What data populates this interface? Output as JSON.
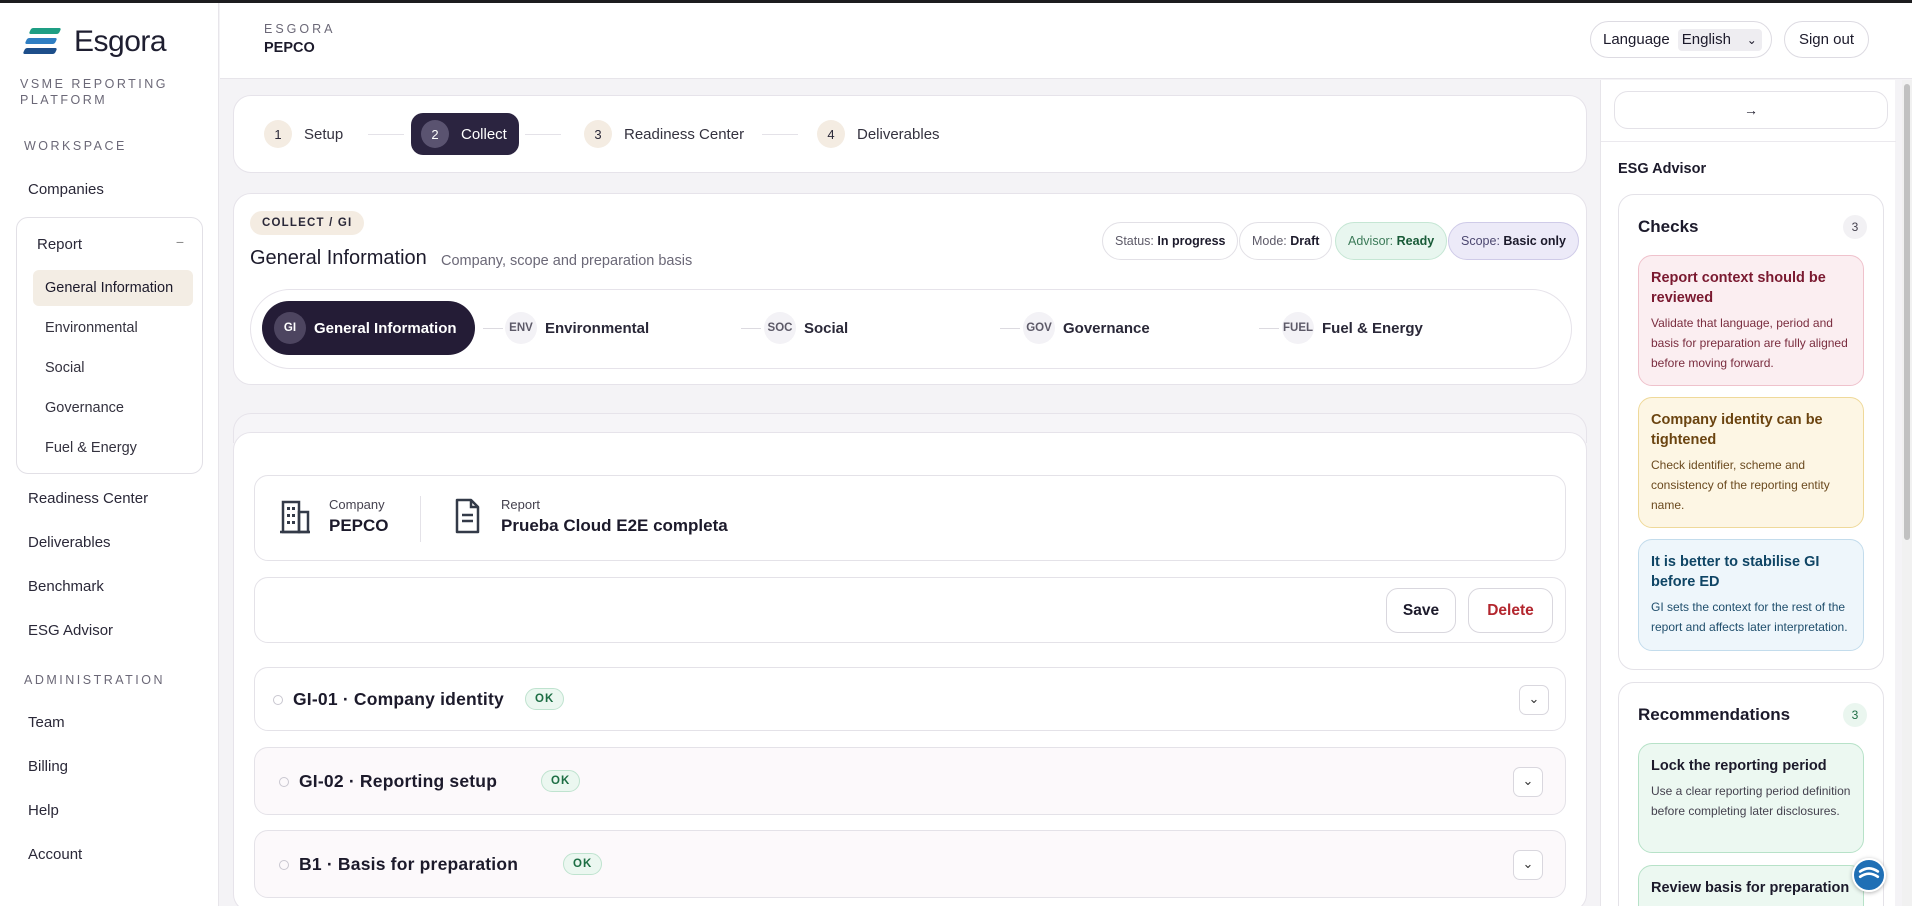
{
  "brand": {
    "name": "Esgora",
    "platform": "VSME REPORTING PLATFORM",
    "colors": [
      "#1e9e84",
      "#2f7ec2",
      "#1d4e8a"
    ]
  },
  "sidebar": {
    "workspace_label": "WORKSPACE",
    "companies": "Companies",
    "report": {
      "label": "Report",
      "toggle": "−",
      "items": [
        "General Information",
        "Environmental",
        "Social",
        "Governance",
        "Fuel & Energy"
      ]
    },
    "readiness": "Readiness Center",
    "deliverables": "Deliverables",
    "benchmark": "Benchmark",
    "esg_advisor": "ESG Advisor",
    "admin_label": "ADMINISTRATION",
    "team": "Team",
    "billing": "Billing",
    "help": "Help",
    "account": "Account"
  },
  "header": {
    "brand": "ESGORA",
    "company": "PEPCO",
    "language_label": "Language",
    "language_value": "English",
    "signout": "Sign out"
  },
  "stepper": [
    {
      "num": "1",
      "label": "Setup"
    },
    {
      "num": "2",
      "label": "Collect"
    },
    {
      "num": "3",
      "label": "Readiness Center"
    },
    {
      "num": "4",
      "label": "Deliverables"
    }
  ],
  "gi": {
    "tag": "COLLECT / GI",
    "title": "General Information",
    "subtitle": "Company, scope and preparation basis",
    "status": {
      "label": "Status:",
      "value": "In progress"
    },
    "mode": {
      "label": "Mode:",
      "value": "Draft"
    },
    "advisor": {
      "label": "Advisor:",
      "value": "Ready"
    },
    "scope": {
      "label": "Scope:",
      "value": "Basic only"
    },
    "tabs": [
      {
        "code": "GI",
        "label": "General Information"
      },
      {
        "code": "ENV",
        "label": "Environmental"
      },
      {
        "code": "SOC",
        "label": "Social"
      },
      {
        "code": "GOV",
        "label": "Governance"
      },
      {
        "code": "FUEL",
        "label": "Fuel & Energy"
      }
    ]
  },
  "form": {
    "company_label": "Company",
    "company_value": "PEPCO",
    "report_label": "Report",
    "report_value": "Prueba Cloud E2E completa",
    "save": "Save",
    "delete": "Delete",
    "sections": [
      {
        "title": "GI-01 · Company identity",
        "status": "OK"
      },
      {
        "title": "GI-02 · Reporting setup",
        "status": "OK"
      },
      {
        "title": "B1 · Basis for preparation",
        "status": "OK"
      }
    ],
    "expand_glyph": "⌄"
  },
  "advisor": {
    "collapse_glyph": "→",
    "title": "ESG Advisor",
    "checks": {
      "title": "Checks",
      "count": "3",
      "items": [
        {
          "title": "Report context should be reviewed",
          "desc": "Validate that language, period and basis for preparation are fully aligned before moving forward."
        },
        {
          "title": "Company identity can be tightened",
          "desc": "Check identifier, scheme and consistency of the reporting entity name."
        },
        {
          "title": "It is better to stabilise GI before ED",
          "desc": "GI sets the context for the rest of the report and affects later interpretation."
        }
      ]
    },
    "recommendations": {
      "title": "Recommendations",
      "count": "3",
      "items": [
        {
          "title": "Lock the reporting period",
          "desc": "Use a clear reporting period definition before completing later disclosures."
        },
        {
          "title": "Review basis for preparation",
          "desc": ""
        }
      ]
    }
  }
}
